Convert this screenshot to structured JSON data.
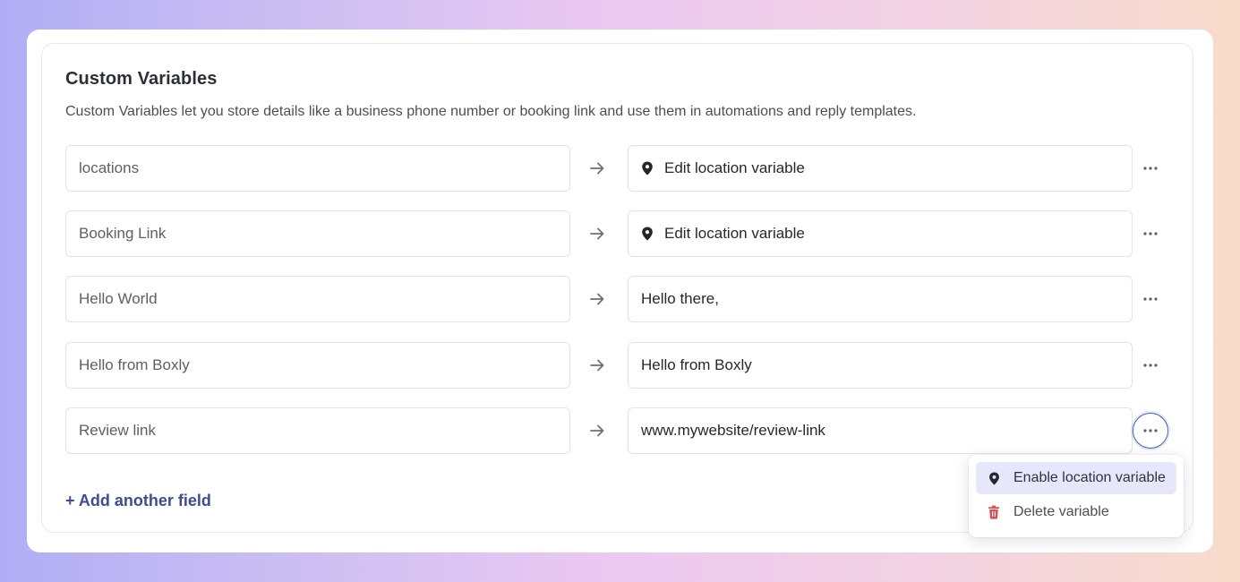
{
  "section": {
    "title": "Custom Variables",
    "description": "Custom Variables let you store details like a business phone number or booking link and use them in automations and reply templates."
  },
  "rows": [
    {
      "key": "locations",
      "value": "Edit location variable",
      "is_location": true
    },
    {
      "key": "Booking Link",
      "value": "Edit location variable",
      "is_location": true
    },
    {
      "key": "Hello World",
      "value": "Hello there,",
      "is_location": false
    },
    {
      "key": "Hello from Boxly",
      "value": "Hello from Boxly",
      "is_location": false
    },
    {
      "key": "Review link",
      "value": "www.mywebsite/review-link",
      "is_location": false
    }
  ],
  "add_field_label": "+ Add another field",
  "menu": {
    "items": [
      {
        "label": "Enable location variable",
        "icon": "map-pin-icon"
      },
      {
        "label": "Delete variable",
        "icon": "trash-icon"
      }
    ]
  },
  "colors": {
    "accent": "#3e4a9a",
    "menu_highlight": "#e6e7fb",
    "danger": "#e5484d",
    "focus_ring": "#3d63b8"
  }
}
